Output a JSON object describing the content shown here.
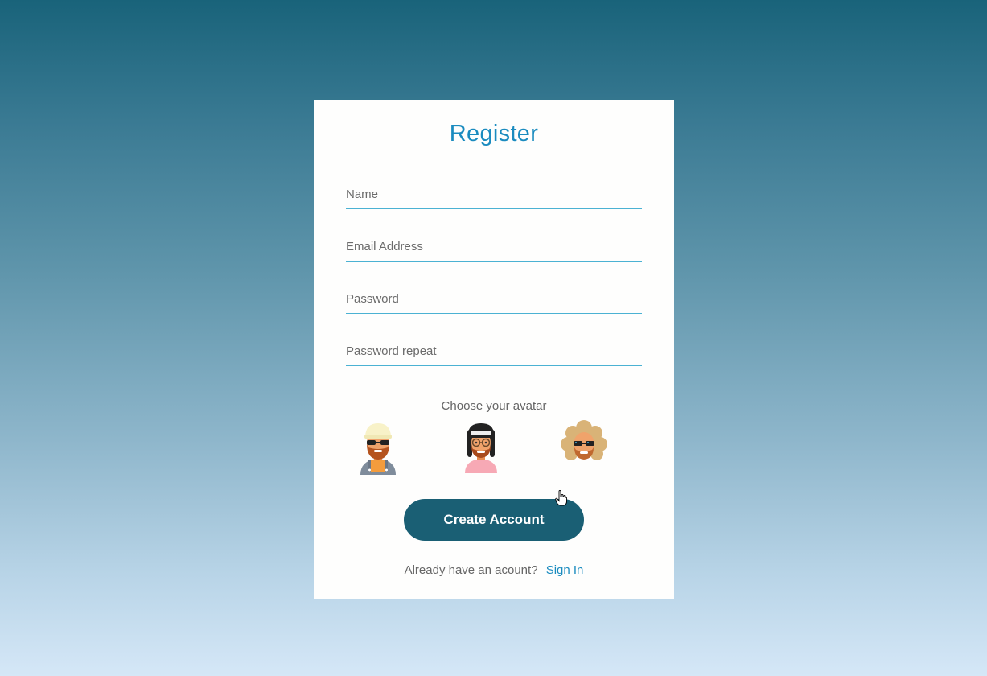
{
  "register": {
    "title": "Register",
    "fields": {
      "name_placeholder": "Name",
      "email_placeholder": "Email Address",
      "password_placeholder": "Password",
      "password_repeat_placeholder": "Password repeat"
    },
    "avatar_label": "Choose your avatar",
    "avatars": [
      "avatar-bearded-sunglasses-icon",
      "avatar-glasses-longhair-icon",
      "avatar-curly-sunglasses-icon"
    ],
    "create_button": "Create Account",
    "footer_text": "Already have an acount?",
    "signin_link": "Sign In"
  },
  "colors": {
    "accent": "#1a8bbf",
    "button": "#1a5f74",
    "field_underline": "#4bb2d3"
  }
}
